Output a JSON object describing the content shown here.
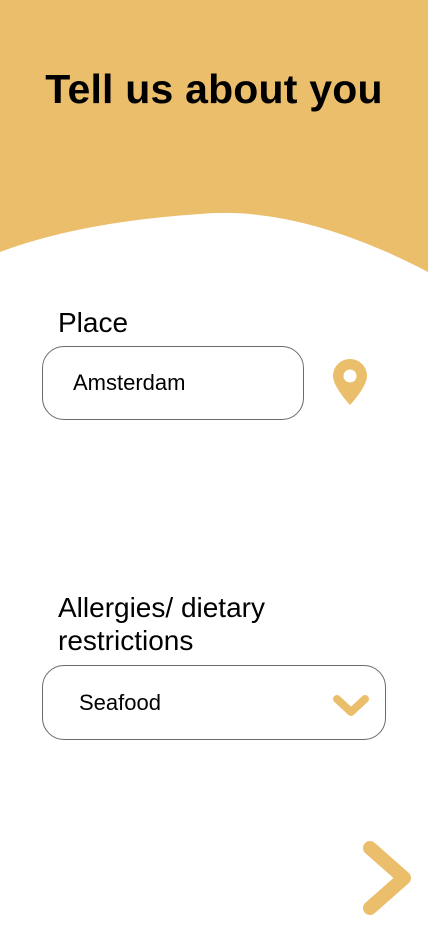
{
  "colors": {
    "accent": "#EBBE6C",
    "border": "#6B6B6B",
    "background": "#FFFFFF",
    "text": "#000000"
  },
  "header": {
    "title": "Tell us about you"
  },
  "place": {
    "label": "Place",
    "value": "Amsterdam",
    "location_icon": "map-pin-icon"
  },
  "allergies": {
    "label": "Allergies/ dietary restrictions",
    "selected": "Seafood",
    "dropdown_icon": "chevron-down-icon"
  },
  "navigation": {
    "next_icon": "chevron-right-icon"
  }
}
